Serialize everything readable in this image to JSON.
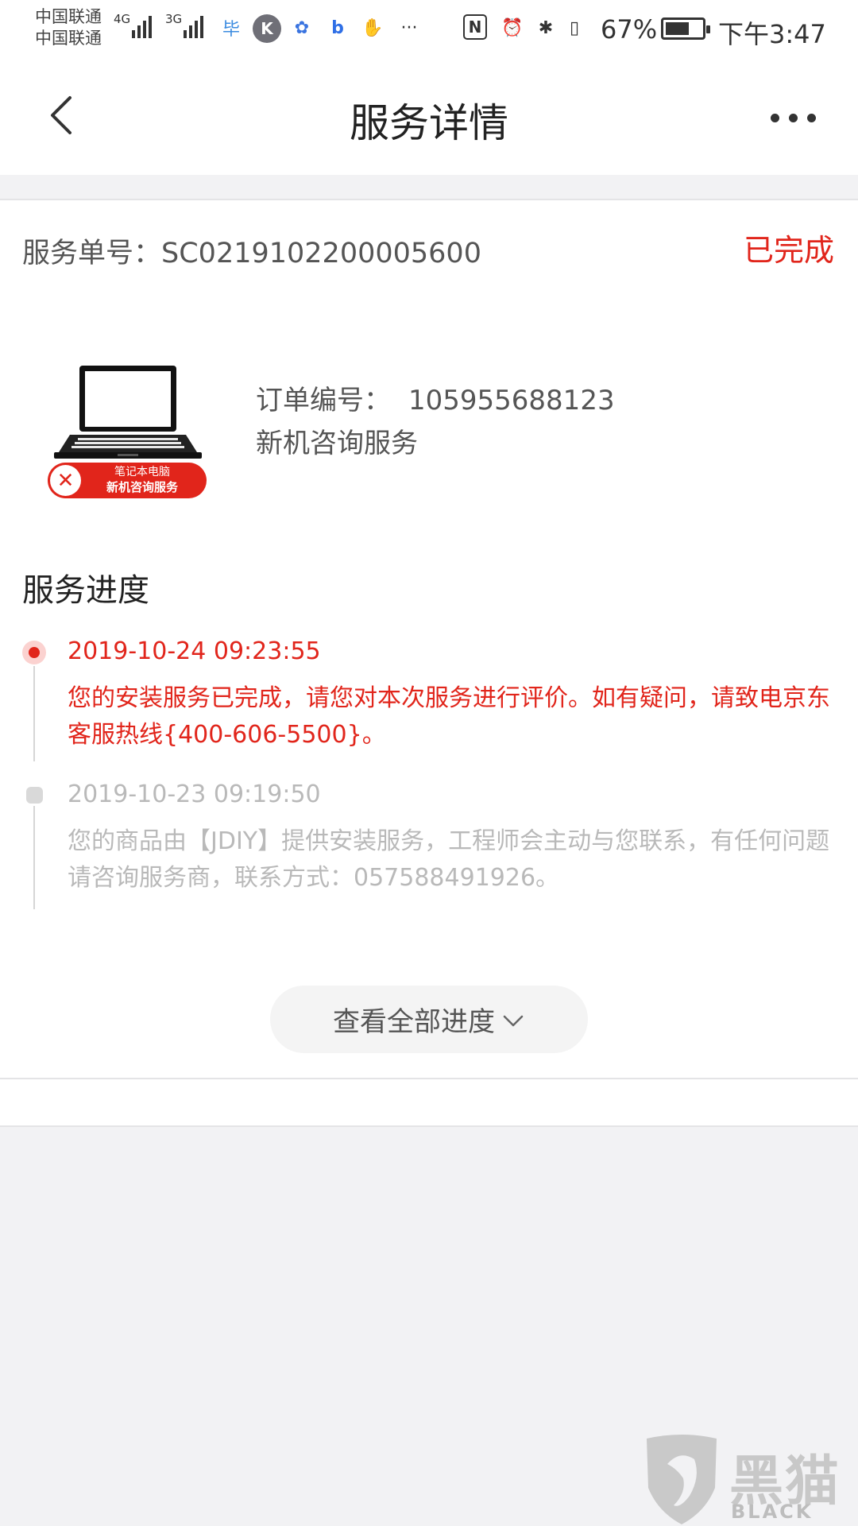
{
  "status_bar": {
    "carrier1": "中国联通",
    "carrier2": "中国联通",
    "net1": "4G",
    "net2": "3G",
    "battery": "67%",
    "battery_level": 0.67,
    "time": "下午3:47",
    "icons": [
      "signal-icon",
      "app-icon",
      "k-icon",
      "baidu-icon",
      "browser-icon",
      "shield-icon",
      "more-icon",
      "nfc-icon",
      "alarm-icon",
      "bluetooth-icon",
      "vibrate-icon",
      "battery-icon"
    ]
  },
  "navbar": {
    "title": "服务详情",
    "back_icon": "chevron-left-icon",
    "more_icon": "more-dots-icon"
  },
  "service": {
    "number_label": "服务单号：",
    "number": "SC0219102200005600",
    "status": "已完成",
    "status_color": "#e1251b"
  },
  "product": {
    "badge_line1": "笔记本电脑",
    "badge_line2": "新机咨询服务",
    "order_label": "订单编号：",
    "order_number": "105955688123",
    "name": "新机咨询服务"
  },
  "progress": {
    "title": "服务进度",
    "items": [
      {
        "time": "2019-10-24 09:23:55",
        "text": "您的安装服务已完成，请您对本次服务进行评价。如有疑问，请致电京东客服热线{400-606-5500}。",
        "active": true
      },
      {
        "time": "2019-10-23 09:19:50",
        "text": "您的商品由【JDIY】提供安装服务，工程师会主动与您联系，有任何问题请咨询服务商，联系方式：057588491926。",
        "active": false
      }
    ],
    "view_all": "查看全部进度"
  },
  "watermark": {
    "text": "黑猫",
    "sub": "BLACK CAT"
  }
}
